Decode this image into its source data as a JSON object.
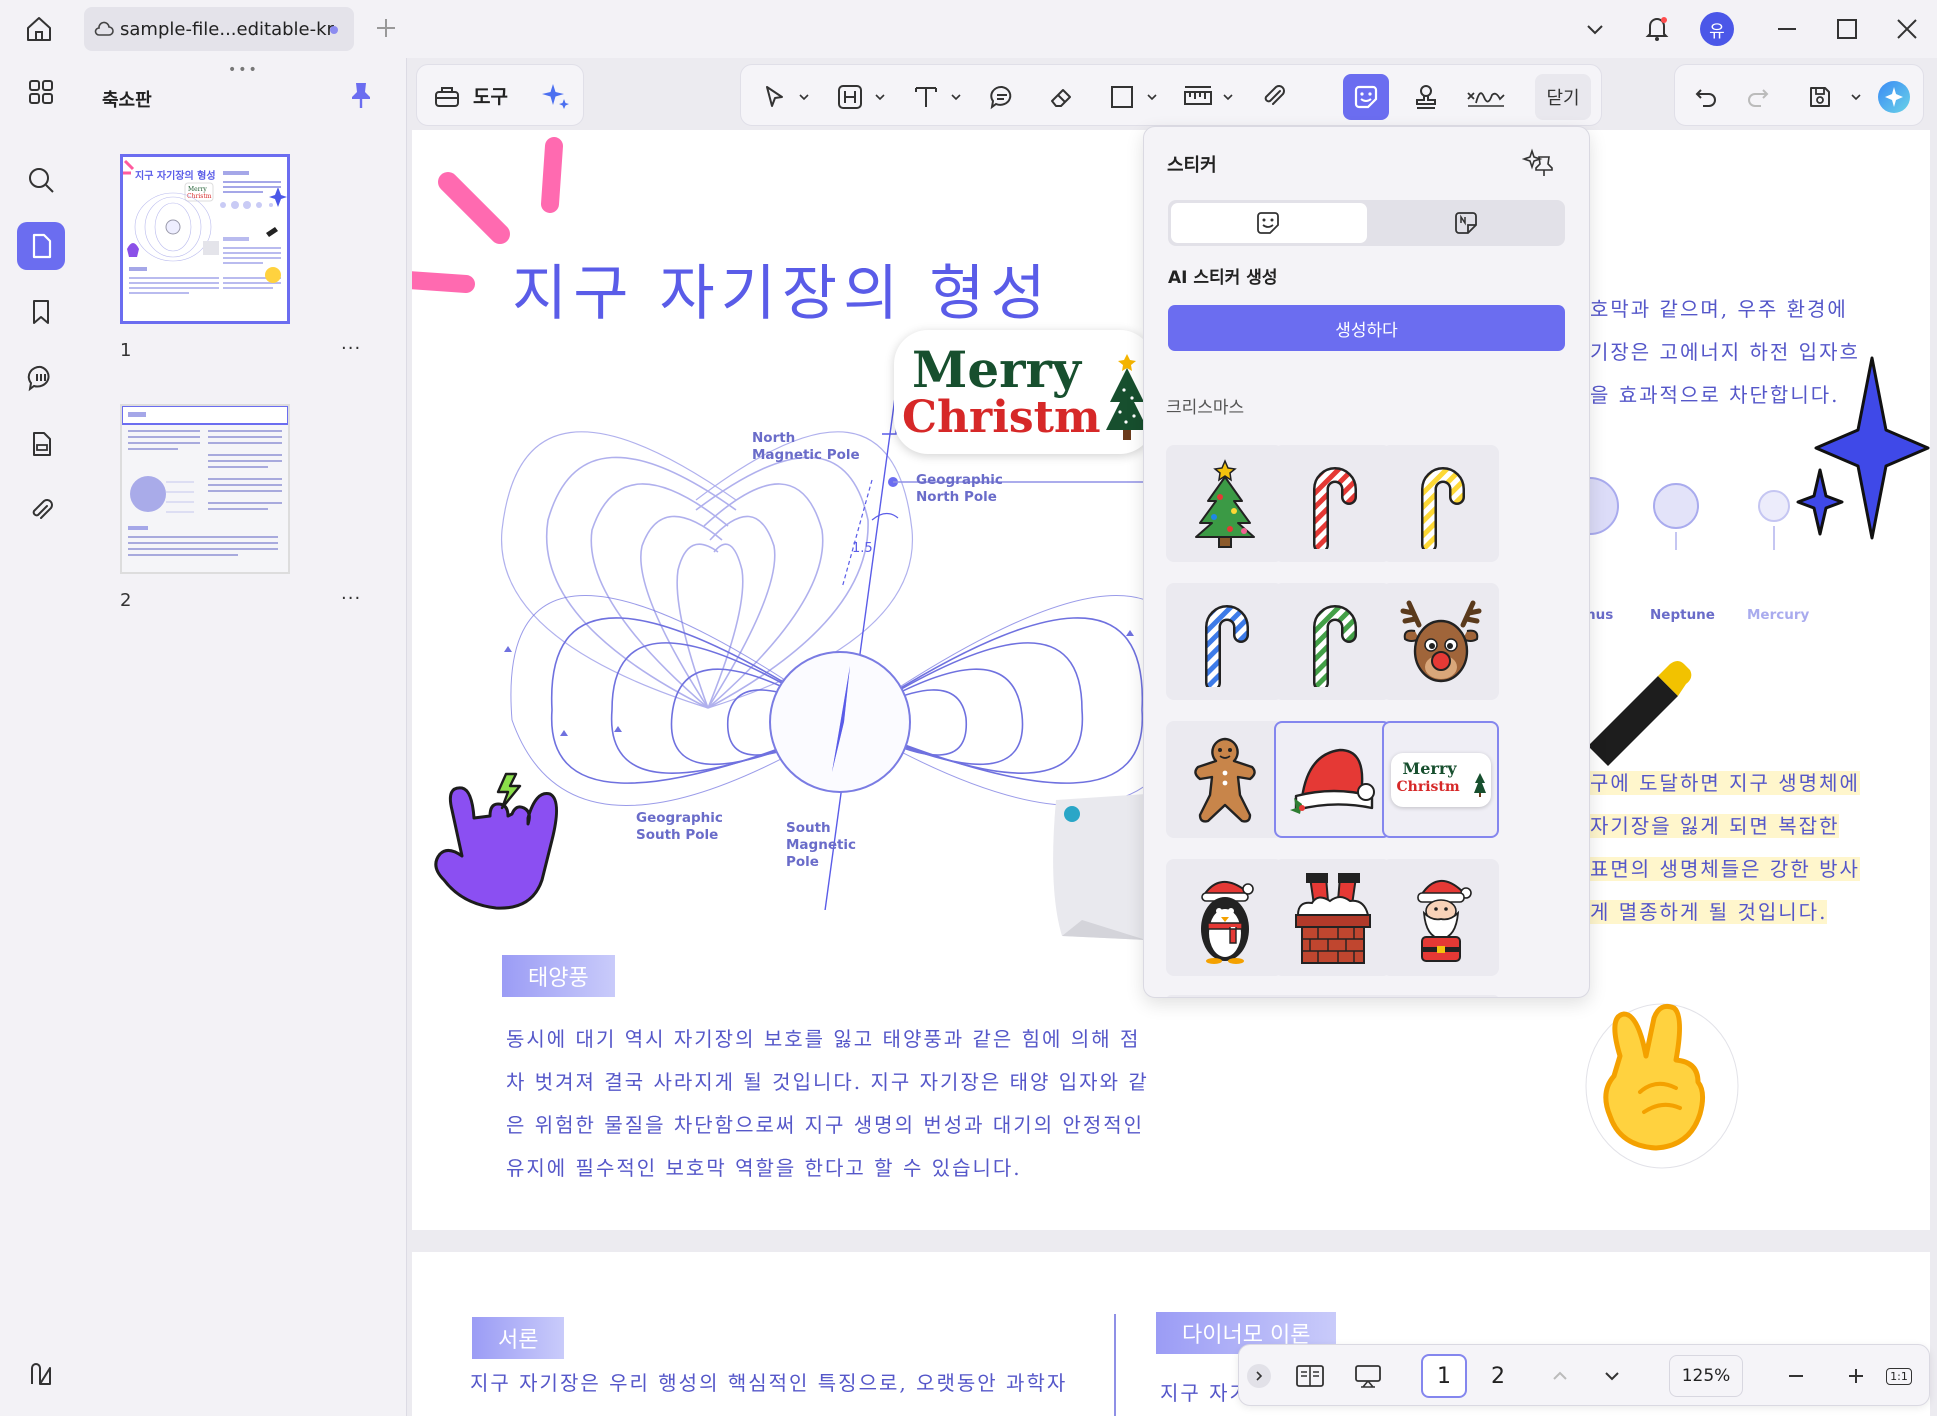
{
  "titlebar": {
    "tab_label": "sample-file...editable-kr",
    "user_initial": "유"
  },
  "thumbnail_panel": {
    "title": "축소판",
    "pages": [
      {
        "number": "1",
        "more": "···"
      },
      {
        "number": "2",
        "more": "···"
      }
    ]
  },
  "toolbar": {
    "tools_label": "도구",
    "close_label": "닫기"
  },
  "document": {
    "title": "지구 자기장의 형성",
    "diagram_labels": {
      "north_magnetic_pole": [
        "North",
        "Magnetic Pole"
      ],
      "geographic_north_pole": [
        "Geographic",
        "North Pole"
      ],
      "geographic_south_pole": [
        "Geographic",
        "South Pole"
      ],
      "south_magnetic_pole": [
        "South",
        "Magnetic",
        "Pole"
      ],
      "angle": "1.5"
    },
    "planet_labels": [
      "nus",
      "Neptune",
      "Mercury"
    ],
    "sticker_text": {
      "line1": "Merry",
      "line2": "Christm"
    },
    "right_text_top": [
      "호막과 같으며, 우주 환경에",
      "기장은 고에너지 하전 입자흐",
      "을 효과적으로 차단합니다."
    ],
    "right_text_bottom": [
      "구에 도달하면 지구 생명체에",
      "자기장을 잃게 되면 복잡한",
      "표면의 생명체들은 강한 방사",
      "게 멸종하게 될 것입니다."
    ],
    "section_solar_wind": "태양풍",
    "solar_wind_text": [
      "동시에 대기 역시 자기장의 보호를 잃고 태양풍과 같은 힘에 의해 점",
      "차 벗겨져 결국 사라지게 될 것입니다. 지구 자기장은 태양 입자와 같",
      "은 위험한 물질을 차단함으로써 지구 생명의 번성과 대기의 안정적인",
      "유지에 필수적인 보호막 역할을 한다고 할 수 있습니다."
    ],
    "section_intro": "서론",
    "intro_text": "지구 자기장은 우리 행성의 핵심적인 특징으로, 오랫동안 과학자",
    "section_dynamo": "다이너모 이론",
    "dynamo_text": "지구 자기"
  },
  "sticker_panel": {
    "title": "스티커",
    "ai_label": "AI 스티커 생성",
    "generate_button": "생성하다",
    "category": "크리스마스",
    "merry_sticker": {
      "line1": "Merry",
      "line2": "Christm"
    }
  },
  "bottom_bar": {
    "pages": [
      "1",
      "2"
    ],
    "zoom": "125%",
    "fit_label": "1:1"
  },
  "colors": {
    "accent": "#6b6df0",
    "doc_text": "#5557c9"
  }
}
